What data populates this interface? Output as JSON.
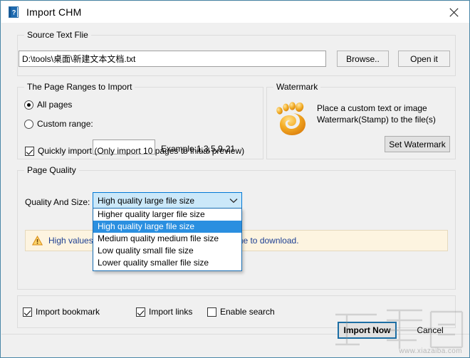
{
  "window": {
    "title": "Import CHM",
    "icon": "chm-book-icon",
    "close_label": "close-icon"
  },
  "source_group": {
    "legend": "Source Text Flie",
    "path_value": "D:\\tools\\桌面\\新建文本文档.txt",
    "path_placeholder": "",
    "browse_label": "Browse..",
    "open_label": "Open it"
  },
  "page_ranges_group": {
    "legend": "The Page Ranges to Import",
    "all_pages_label": "All pages",
    "all_pages_checked": true,
    "custom_range_label": "Custom range:",
    "custom_range_checked": false,
    "custom_range_value": "",
    "example_label": "Example:1,3,5,9-21",
    "quickly_import_label": "Quickly import (Only import 10 pages to  initial  preview)",
    "quickly_import_checked": true
  },
  "watermark_group": {
    "legend": "Watermark",
    "icon": "footprint-icon",
    "description_line1": "Place a custom text or image",
    "description_line2": "Watermark(Stamp) to the file(s)",
    "set_watermark_label": "Set Watermark"
  },
  "page_quality_group": {
    "legend": "Page Quality",
    "quality_label": "Quality And Size:",
    "selected_option": "High quality large file size",
    "options": [
      "Higher quality larger file size",
      "High quality large file size",
      "Medium quality medium file size",
      "Low quality small file size",
      "Lower quality smaller file size"
    ],
    "selected_index": 1,
    "dropdown_open": true,
    "warning_icon": "warning-triangle-icon",
    "warning_text_left": "High values pr",
    "warning_text_right": "disk space and more time to download.",
    "warning_text_full": "High values produce more disk space and more time to download."
  },
  "options_group": {
    "import_bookmark_label": "Import bookmark",
    "import_bookmark_checked": true,
    "import_links_label": "Import links",
    "import_links_checked": true,
    "enable_search_label": "Enable search",
    "enable_search_checked": false
  },
  "footer": {
    "import_now_label": "Import Now",
    "cancel_label": "Cancel"
  },
  "site_watermark": {
    "url_text": "www.xiazaiba.com"
  },
  "colors": {
    "window_border": "#4a87a8",
    "client_bg": "#f0f0f0",
    "group_border": "#dcdcdc",
    "combo_border": "#0078d7",
    "combo_bg": "#cbe8f9",
    "list_highlight": "#2a8fe0",
    "warning_bg": "#fdf4e0",
    "warning_text": "#1d3f92",
    "default_button_border": "#1c6ea4",
    "watermark_icon": "#f0a41e"
  }
}
